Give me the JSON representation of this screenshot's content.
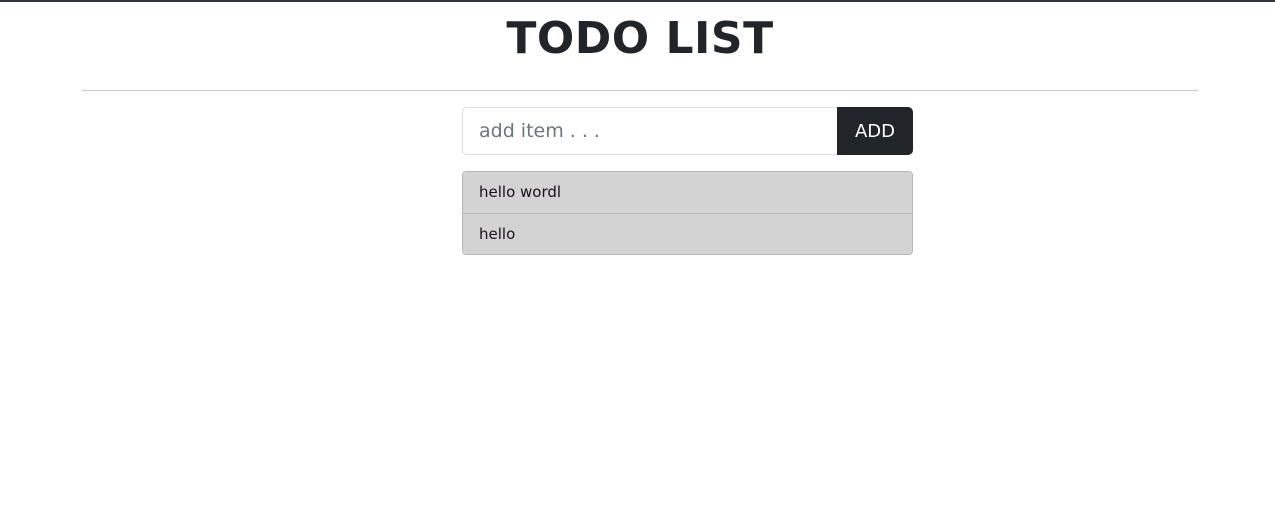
{
  "header": {
    "title": "TODO LIST"
  },
  "form": {
    "input_placeholder": "add item . . .",
    "input_value": "",
    "add_label": "ADD"
  },
  "todos": {
    "items": [
      {
        "label": "hello wordl"
      },
      {
        "label": "hello"
      }
    ]
  },
  "colors": {
    "button_bg": "#212529",
    "item_bg": "#d3d3d3"
  }
}
